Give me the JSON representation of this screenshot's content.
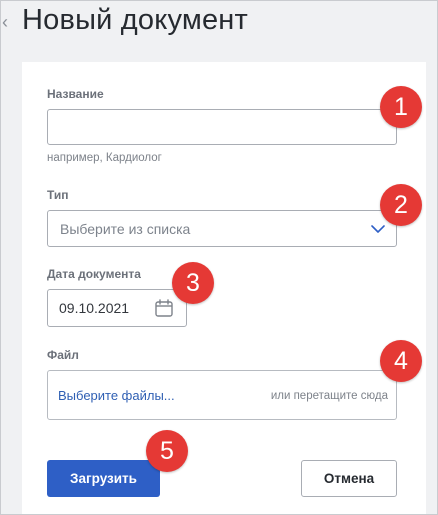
{
  "header": {
    "title": "Новый документ",
    "back_icon": "chevron-left-icon"
  },
  "form": {
    "name": {
      "label": "Название",
      "value": "",
      "hint": "например, Кардиолог"
    },
    "type": {
      "label": "Тип",
      "placeholder": "Выберите из списка",
      "icon": "chevron-down-icon"
    },
    "date": {
      "label": "Дата документа",
      "value": "09.10.2021",
      "icon": "calendar-icon"
    },
    "file": {
      "label": "Файл",
      "choose_text": "Выберите файлы...",
      "drag_text": "или перетащите сюда"
    }
  },
  "buttons": {
    "upload_label": "Загрузить",
    "cancel_label": "Отмена"
  },
  "badges": [
    "1",
    "2",
    "3",
    "4",
    "5"
  ],
  "colors": {
    "accent": "#2e5fc6",
    "badge": "#e53935",
    "link": "#2f5fb3",
    "background": "#f0f1f3"
  }
}
